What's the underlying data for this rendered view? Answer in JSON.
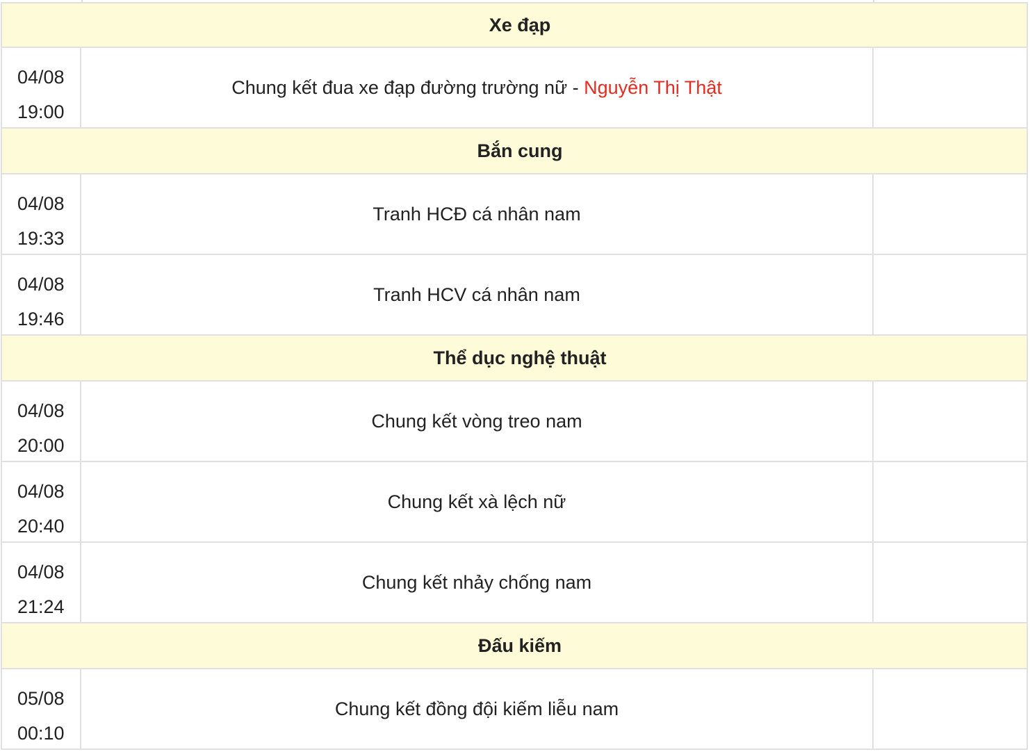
{
  "groups": [
    {
      "title": "Xe đạp",
      "events": [
        {
          "date": "04/08",
          "time": "19:00",
          "name": "Chung kết đua xe đạp đường trường nữ - ",
          "athlete": "Nguyễn Thị Thật"
        }
      ]
    },
    {
      "title": "Bắn cung",
      "events": [
        {
          "date": "04/08",
          "time": "19:33",
          "name": "Tranh HCĐ cá nhân nam",
          "athlete": ""
        },
        {
          "date": "04/08",
          "time": "19:46",
          "name": "Tranh HCV cá nhân nam",
          "athlete": ""
        }
      ]
    },
    {
      "title": "Thể dục nghệ thuật",
      "events": [
        {
          "date": "04/08",
          "time": "20:00",
          "name": "Chung kết vòng treo nam",
          "athlete": ""
        },
        {
          "date": "04/08",
          "time": "20:40",
          "name": "Chung kết xà lệch nữ",
          "athlete": ""
        },
        {
          "date": "04/08",
          "time": "21:24",
          "name": "Chung kết nhảy chống nam",
          "athlete": ""
        }
      ]
    },
    {
      "title": "Đấu kiếm",
      "events": [
        {
          "date": "05/08",
          "time": "00:10",
          "name": "Chung kết đồng đội kiếm liễu nam",
          "athlete": ""
        }
      ]
    }
  ],
  "colors": {
    "group_bg": "#fefbd8",
    "border": "#e0e0e0",
    "athlete": "#e52b1e",
    "text": "#222222"
  }
}
